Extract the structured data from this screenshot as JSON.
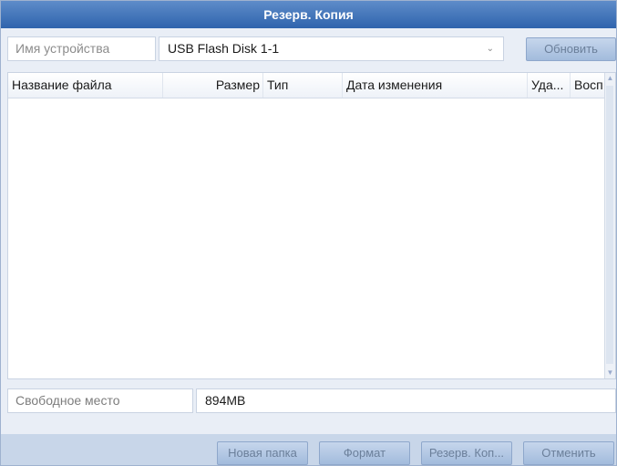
{
  "window": {
    "title": "Резерв. Копия"
  },
  "device": {
    "label": "Имя устройства",
    "selected": "USB Flash Disk 1-1",
    "refresh_label": "Обновить"
  },
  "table": {
    "columns": [
      {
        "key": "name",
        "label": "Название файла"
      },
      {
        "key": "size",
        "label": "Размер"
      },
      {
        "key": "type",
        "label": "Тип"
      },
      {
        "key": "modified",
        "label": "Дата изменения"
      },
      {
        "key": "delete",
        "label": "Уда..."
      },
      {
        "key": "play",
        "label": "Восп"
      }
    ],
    "rows": []
  },
  "storage": {
    "free_label": "Свободное место",
    "free_value": "894MB"
  },
  "actions": {
    "new_folder": "Новая папка",
    "format": "Формат",
    "backup": "Резерв. Коп...",
    "cancel": "Отменить"
  },
  "icons": {
    "dropdown": "chevron-down-icon",
    "scroll_up": "arrow-up-icon",
    "scroll_down": "arrow-down-icon"
  },
  "colors": {
    "title_bar": "#2f64ad",
    "background": "#e9eef6",
    "button": "#a2bbdc",
    "button_text": "#6b7f9a"
  }
}
